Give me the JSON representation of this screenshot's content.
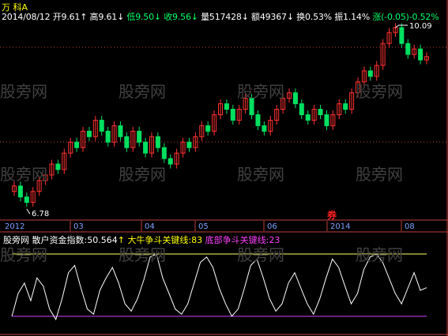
{
  "header": {
    "stock_name": "万  科A",
    "date": "2014/08/12",
    "open_label": "开",
    "open": "9.61",
    "high_label": "高",
    "high": "9.61",
    "low_label": "低",
    "low": "9.50",
    "close_label": "收",
    "close": "9.56",
    "volume_label": "量",
    "volume": "517428",
    "amount_label": "额",
    "amount": "49367",
    "turnover_label": "换",
    "turnover": "0.53%",
    "amplitude_label": "振",
    "amplitude": "1.14%",
    "change_label": "涨",
    "change": "(-0.05)",
    "change_pct": "-0.52%"
  },
  "indicator": {
    "source": "股旁网",
    "name": "散户资金指数",
    "value": "50.564",
    "bull_label": "大牛争斗关键线",
    "bull_value": "83",
    "bottom_label": "底部争斗关键线",
    "bottom_value": "23"
  },
  "price_labels": {
    "high": "10.09",
    "low": "6.78"
  },
  "time_axis": [
    "2012",
    "03",
    "04",
    "05",
    "06",
    "2014",
    "08"
  ],
  "watermark": "股旁网",
  "marker_text": "券",
  "colors": {
    "up": "#ff3232",
    "down": "#00e060",
    "bull_line": "#ffff66",
    "bottom_line": "#cc44ff",
    "axis": "#c04040",
    "index_line": "#ffffff"
  },
  "chart_data": {
    "type": "candlestick",
    "series": [
      {
        "name": "price",
        "values": [
          7.2,
          7.0,
          6.9,
          7.1,
          7.3,
          7.4,
          7.6,
          7.5,
          7.8,
          8.0,
          7.9,
          8.2,
          8.1,
          8.4,
          8.2,
          8.0,
          8.3,
          8.1,
          7.9,
          8.2,
          8.0,
          7.8,
          8.1,
          7.9,
          7.7,
          7.6,
          7.8,
          8.0,
          7.9,
          8.1,
          8.3,
          8.2,
          8.5,
          8.7,
          8.6,
          8.4,
          8.6,
          8.8,
          8.5,
          8.3,
          8.2,
          8.4,
          8.6,
          8.8,
          8.9,
          8.7,
          8.5,
          8.4,
          8.6,
          8.5,
          8.3,
          8.5,
          8.7,
          8.6,
          8.9,
          9.1,
          9.3,
          9.2,
          9.4,
          9.8,
          10.0,
          10.09,
          9.8,
          9.6,
          9.7,
          9.5,
          9.56
        ]
      },
      {
        "name": "散户资金指数",
        "values": [
          23,
          45,
          55,
          38,
          60,
          52,
          30,
          20,
          40,
          65,
          72,
          50,
          30,
          25,
          48,
          60,
          70,
          55,
          35,
          28,
          40,
          58,
          80,
          83,
          60,
          45,
          30,
          25,
          35,
          55,
          75,
          80,
          70,
          50,
          35,
          23,
          30,
          50,
          72,
          78,
          60,
          40,
          28,
          35,
          55,
          65,
          50,
          35,
          25,
          40,
          60,
          78,
          70,
          52,
          35,
          45,
          68,
          80,
          83,
          75,
          60,
          45,
          35,
          50,
          65,
          48,
          50.564
        ]
      }
    ],
    "ylim": [
      6.78,
      10.09
    ],
    "indicator_lines": {
      "bull": 83,
      "bottom": 23
    }
  }
}
